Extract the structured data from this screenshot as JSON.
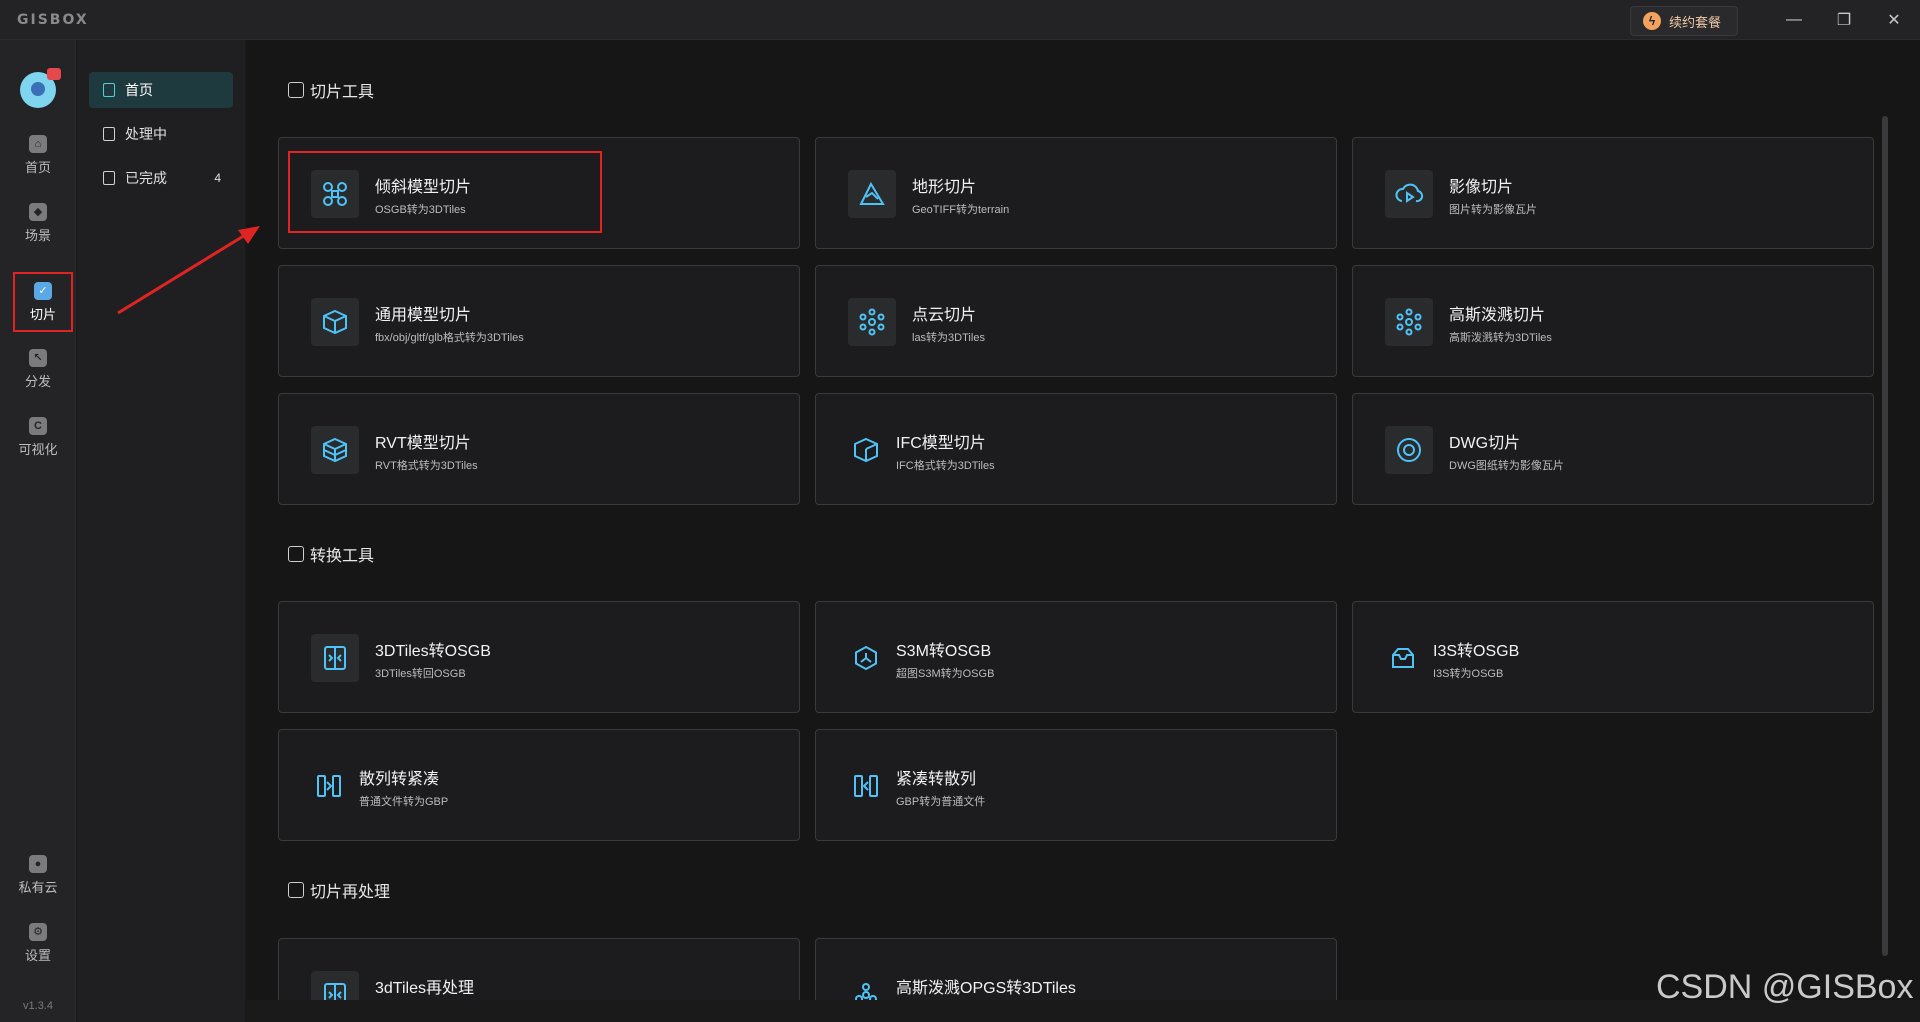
{
  "app": {
    "logo": "GISBOX",
    "renew_label": "续约套餐",
    "version": "v1.3.4"
  },
  "window_controls": {
    "minimize": "—",
    "restore": "❐",
    "close": "✕"
  },
  "rail": {
    "items": [
      {
        "label": "首页",
        "icon": "home-icon",
        "glyph": "⌂"
      },
      {
        "label": "场景",
        "icon": "cube-icon",
        "glyph": "◆"
      },
      {
        "label": "切片",
        "icon": "slice-doc-icon",
        "glyph": "✓"
      },
      {
        "label": "分发",
        "icon": "distribute-icon",
        "glyph": "↖"
      },
      {
        "label": "可视化",
        "icon": "visualize-icon",
        "glyph": "C"
      }
    ],
    "bottom_items": [
      {
        "label": "私有云",
        "icon": "lock-icon",
        "glyph": "●"
      },
      {
        "label": "设置",
        "icon": "gear-icon",
        "glyph": "⚙"
      }
    ]
  },
  "nav": {
    "items": [
      {
        "label": "首页",
        "count": ""
      },
      {
        "label": "处理中",
        "count": ""
      },
      {
        "label": "已完成",
        "count": "4"
      }
    ]
  },
  "sections": {
    "slice_tools": {
      "title": "切片工具",
      "cards": [
        {
          "title": "倾斜模型切片",
          "subtitle": "OSGB转为3DTiles",
          "icon": "drone-icon"
        },
        {
          "title": "地形切片",
          "subtitle": "GeoTIFF转为terrain",
          "icon": "terrain-icon"
        },
        {
          "title": "影像切片",
          "subtitle": "图片转为影像瓦片",
          "icon": "image-cloud-icon"
        },
        {
          "title": "通用模型切片",
          "subtitle": "fbx/obj/gltf/glb格式转为3DTiles",
          "icon": "box-icon"
        },
        {
          "title": "点云切片",
          "subtitle": "las转为3DTiles",
          "icon": "pointcloud-icon"
        },
        {
          "title": "高斯泼溅切片",
          "subtitle": "高斯泼溅转为3DTiles",
          "icon": "gaussian-icon"
        },
        {
          "title": "RVT模型切片",
          "subtitle": "RVT格式转为3DTiles",
          "icon": "rvt-icon"
        },
        {
          "title": "IFC模型切片",
          "subtitle": "IFC格式转为3DTiles",
          "icon": "ifc-icon"
        },
        {
          "title": "DWG切片",
          "subtitle": "DWG图纸转为影像瓦片",
          "icon": "dwg-icon"
        }
      ]
    },
    "convert_tools": {
      "title": "转换工具",
      "cards": [
        {
          "title": "3DTiles转OSGB",
          "subtitle": "3DTiles转回OSGB",
          "icon": "convert-icon"
        },
        {
          "title": "S3M转OSGB",
          "subtitle": "超图S3M转为OSGB",
          "icon": "hexagon-icon"
        },
        {
          "title": "I3S转OSGB",
          "subtitle": "I3S转为OSGB",
          "icon": "inbox-icon"
        },
        {
          "title": "散列转紧凑",
          "subtitle": "普通文件转为GBP",
          "icon": "compact-icon"
        },
        {
          "title": "紧凑转散列",
          "subtitle": "GBP转为普通文件",
          "icon": "expand-icon"
        }
      ]
    },
    "reprocess": {
      "title": "切片再处理",
      "cards": [
        {
          "title": "3dTiles再处理",
          "subtitle": "",
          "icon": "convert-icon"
        },
        {
          "title": "高斯泼溅OPGS转3DTiles",
          "subtitle": "",
          "icon": "gaussian-flower-icon"
        }
      ]
    }
  },
  "watermark": "CSDN @GISBox",
  "colors": {
    "accent": "#4fc3f7",
    "highlight": "#e02424",
    "active_nav": "#1e3a3f"
  }
}
